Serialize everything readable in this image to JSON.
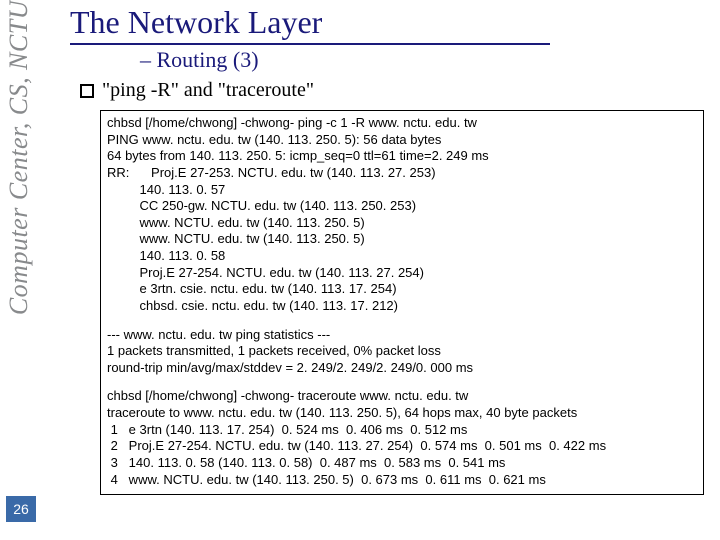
{
  "sidebar": {
    "label": "Computer Center, CS, NCTU"
  },
  "page_number": "26",
  "title": "The Network Layer",
  "subtitle": "– Routing (3)",
  "bullet": "\"ping -R\" and \"traceroute\"",
  "code": {
    "block1": [
      "chbsd [/home/chwong] -chwong- ping -c 1 -R www. nctu. edu. tw",
      "PING www. nctu. edu. tw (140. 113. 250. 5): 56 data bytes",
      "64 bytes from 140. 113. 250. 5: icmp_seq=0 ttl=61 time=2. 249 ms",
      "RR:      Proj.E 27-253. NCTU. edu. tw (140. 113. 27. 253)",
      "         140. 113. 0. 57",
      "         CC 250-gw. NCTU. edu. tw (140. 113. 250. 253)",
      "         www. NCTU. edu. tw (140. 113. 250. 5)",
      "         www. NCTU. edu. tw (140. 113. 250. 5)",
      "         140. 113. 0. 58",
      "         Proj.E 27-254. NCTU. edu. tw (140. 113. 27. 254)",
      "         e 3rtn. csie. nctu. edu. tw (140. 113. 17. 254)",
      "         chbsd. csie. nctu. edu. tw (140. 113. 17. 212)"
    ],
    "block2": [
      "--- www. nctu. edu. tw ping statistics ---",
      "1 packets transmitted, 1 packets received, 0% packet loss",
      "round-trip min/avg/max/stddev = 2. 249/2. 249/2. 249/0. 000 ms"
    ],
    "block3": [
      "chbsd [/home/chwong] -chwong- traceroute www. nctu. edu. tw",
      "traceroute to www. nctu. edu. tw (140. 113. 250. 5), 64 hops max, 40 byte packets",
      " 1   e 3rtn (140. 113. 17. 254)  0. 524 ms  0. 406 ms  0. 512 ms",
      " 2   Proj.E 27-254. NCTU. edu. tw (140. 113. 27. 254)  0. 574 ms  0. 501 ms  0. 422 ms",
      " 3   140. 113. 0. 58 (140. 113. 0. 58)  0. 487 ms  0. 583 ms  0. 541 ms",
      " 4   www. NCTU. edu. tw (140. 113. 250. 5)  0. 673 ms  0. 611 ms  0. 621 ms"
    ]
  }
}
